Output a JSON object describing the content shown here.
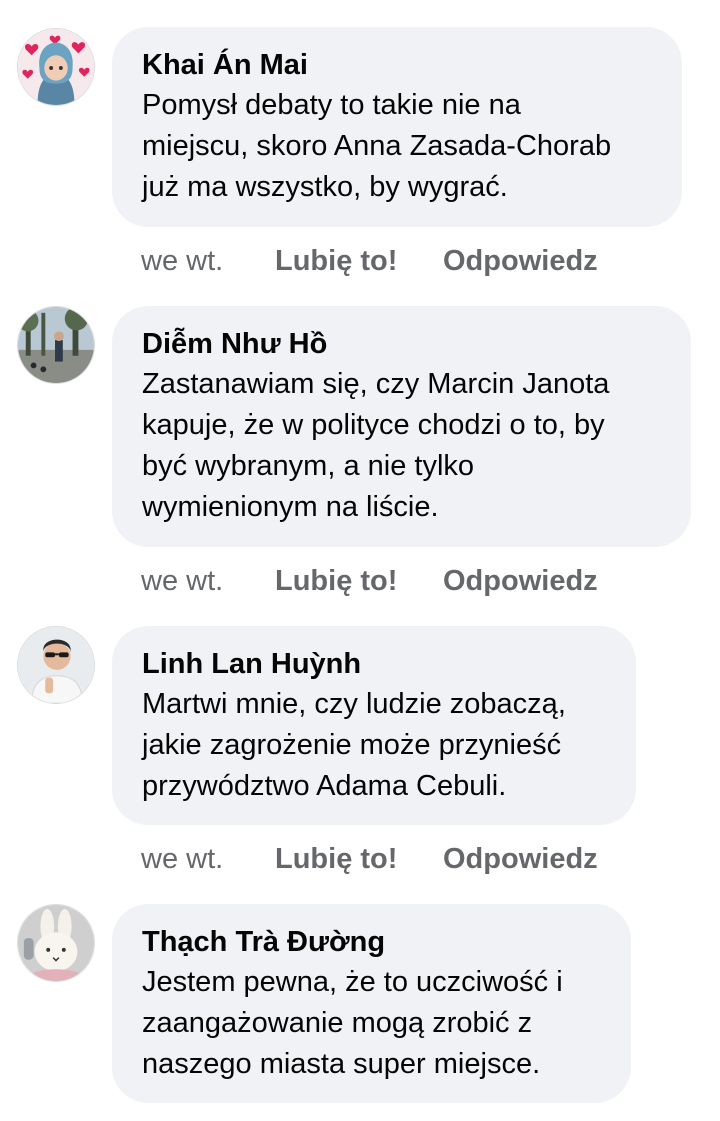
{
  "comments": [
    {
      "avatar_icon": "user-avatar-hearts",
      "author": "Khai Án Mai",
      "text": "Pomysł debaty to takie nie na\nmiejscu, skoro Anna Zasada-Chorab\njuż ma wszystko, by wygrać.",
      "time": "we wt.",
      "like_label": "Lubię to!",
      "reply_label": "Odpowiedz"
    },
    {
      "avatar_icon": "user-avatar-park",
      "author": "Diễm Như Hồ",
      "text": "Zastanawiam się, czy Marcin Janota\nkapuje, że w polityce chodzi o to, by\nbyć wybranym, a nie tylko\nwymienionym na liście.",
      "time": "we wt.",
      "like_label": "Lubię to!",
      "reply_label": "Odpowiedz"
    },
    {
      "avatar_icon": "user-avatar-man-sunglasses",
      "author": "Linh Lan Huỳnh",
      "text": "Martwi mnie, czy ludzie zobaczą,\njakie zagrożenie może przynieść\nprzywództwo Adama Cebuli.",
      "time": "we wt.",
      "like_label": "Lubię to!",
      "reply_label": "Odpowiedz"
    },
    {
      "avatar_icon": "user-avatar-bunny",
      "author": "Thạch Trà Đường",
      "text": "Jestem pewna, że to uczciwość i\nzaangażowanie mogą zrobić z\nnaszego miasta super miejsce."
    }
  ]
}
